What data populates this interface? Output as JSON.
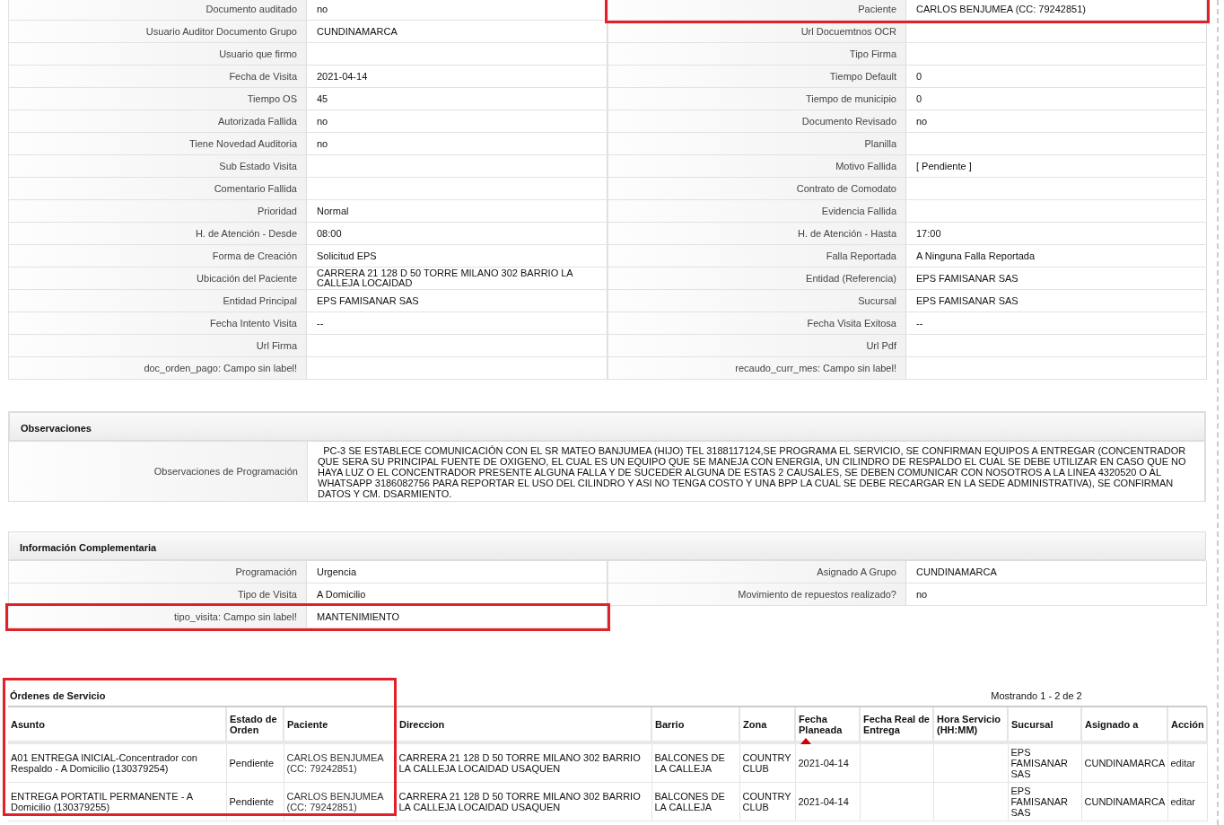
{
  "details": {
    "rows": [
      {
        "left": {
          "label": "Documento auditado",
          "value": "no"
        },
        "right": {
          "label": "Paciente",
          "value": "CARLOS BENJUMEA (CC: 79242851)",
          "highlighted": true
        }
      },
      {
        "left": {
          "label": "Usuario Auditor Documento Grupo",
          "value": "CUNDINAMARCA"
        },
        "right": {
          "label": "Url Docuemtnos OCR"
        }
      },
      {
        "left": {
          "label": "Usuario que firmo"
        },
        "right": {
          "label": "Tipo Firma"
        }
      },
      {
        "left": {
          "label": "Fecha de Visita",
          "value": "2021-04-14"
        },
        "right": {
          "label": "Tiempo Default",
          "value": "0"
        }
      },
      {
        "left": {
          "label": "Tiempo OS",
          "value": "45"
        },
        "right": {
          "label": "Tiempo de municipio",
          "value": "0"
        }
      },
      {
        "left": {
          "label": "Autorizada Fallida",
          "value": "no"
        },
        "right": {
          "label": "Documento Revisado",
          "value": "no"
        }
      },
      {
        "left": {
          "label": "Tiene Novedad Auditoria",
          "value": "no"
        },
        "right": {
          "label": "Planilla"
        }
      },
      {
        "left": {
          "label": "Sub Estado Visita"
        },
        "right": {
          "label": "Motivo Fallida",
          "value": "[ Pendiente ]"
        }
      },
      {
        "left": {
          "label": "Comentario Fallida"
        },
        "right": {
          "label": "Contrato de Comodato"
        }
      },
      {
        "left": {
          "label": "Prioridad",
          "value": "Normal"
        },
        "right": {
          "label": "Evidencia Fallida"
        }
      },
      {
        "left": {
          "label": "H. de Atención - Desde",
          "value": "08:00"
        },
        "right": {
          "label": "H. de Atención - Hasta",
          "value": "17:00"
        }
      },
      {
        "left": {
          "label": "Forma de Creación",
          "value": "Solicitud EPS"
        },
        "right": {
          "label": "Falla Reportada",
          "value": "A Ninguna Falla Reportada"
        }
      },
      {
        "left": {
          "label": "Ubicación del Paciente",
          "value": "CARRERA 21 128 D 50 TORRE MILANO 302 BARRIO LA CALLEJA LOCAIDAD"
        },
        "right": {
          "label": "Entidad (Referencia)",
          "value": "EPS FAMISANAR SAS"
        }
      },
      {
        "left": {
          "label": "Entidad Principal",
          "value": "EPS FAMISANAR SAS"
        },
        "right": {
          "label": "Sucursal",
          "value": "EPS FAMISANAR SAS"
        }
      },
      {
        "left": {
          "label": "Fecha Intento Visita",
          "value": "--"
        },
        "right": {
          "label": "Fecha Visita Exitosa",
          "value": "--"
        }
      },
      {
        "left": {
          "label": "Url Firma"
        },
        "right": {
          "label": "Url Pdf"
        }
      },
      {
        "left": {
          "label": "doc_orden_pago: Campo sin label!"
        },
        "right": {
          "label": "recaudo_curr_mes: Campo sin label!"
        }
      }
    ]
  },
  "observaciones": {
    "title": "Observaciones",
    "label": "Observaciones de Programación",
    "value": "  PC-3 SE ESTABLECE COMUNICACIÓN CON EL SR MATEO BANJUMEA (HIJO) TEL 3188117124,SE PROGRAMA EL SERVICIO, SE CONFIRMAN EQUIPOS A ENTREGAR (CONCENTRADOR QUE SERA SU PRINCIPAL FUENTE DE OXIGENO, EL CUAL ES UN EQUIPO QUE SE MANEJA CON ENERGIA, UN CILINDRO DE RESPALDO EL CUAL SE DEBE UTILIZAR EN CASO QUE NO HAYA LUZ O EL CONCENTRADOR PRESENTE ALGUNA FALLA Y DE SUCEDER ALGUNA DE ESTAS 2 CAUSALES, SE DEBEN COMUNICAR CON NOSOTROS A LA LINEA 4320520 O AL WHATSAPP 3186082756 PARA REPORTAR EL USO DEL CILINDRO Y ASI NO TENGA COSTO Y UNA BPP LA CUAL SE DEBE RECARGAR EN LA SEDE ADMINISTRATIVA), SE CONFIRMAN DATOS Y CM. DSARMIENTO."
  },
  "complementaria": {
    "title": "Información Complementaria",
    "rows": [
      {
        "left": {
          "label": "Programación",
          "value": "Urgencia"
        },
        "right": {
          "label": "Asignado A Grupo",
          "value": "CUNDINAMARCA"
        }
      },
      {
        "left": {
          "label": "Tipo de Visita",
          "value": "A Domicilio"
        },
        "right": {
          "label": "Movimiento de repuestos realizado?",
          "value": "no"
        }
      },
      {
        "left": {
          "label": "tipo_visita: Campo sin label!",
          "value": "MANTENIMIENTO",
          "highlighted": true
        }
      }
    ]
  },
  "orders": {
    "title": "Órdenes de Servicio",
    "highlighted": true,
    "paging": "Mostrando 1 - 2 de 2",
    "columns": [
      {
        "label": "Asunto",
        "sorted": false
      },
      {
        "label": "Estado de Orden",
        "sorted": false
      },
      {
        "label": "Paciente",
        "sorted": false
      },
      {
        "label": "Direccion",
        "sorted": false
      },
      {
        "label": "Barrio",
        "sorted": false
      },
      {
        "label": "Zona",
        "sorted": false
      },
      {
        "label": "Fecha Planeada",
        "sorted": true
      },
      {
        "label": "Fecha Real de Entrega",
        "sorted": false
      },
      {
        "label": "Hora Servicio (HH:MM)",
        "sorted": false
      },
      {
        "label": "Sucursal",
        "sorted": false
      },
      {
        "label": "Asignado a",
        "sorted": false
      },
      {
        "label": "Acción",
        "sorted": false
      }
    ],
    "rows": [
      {
        "cells": [
          "A01 ENTREGA INICIAL-Concentrador con Respaldo - A Domicilio (130379254)",
          "Pendiente",
          "CARLOS BENJUMEA (CC: 79242851)",
          "CARRERA 21 128 D 50 TORRE MILANO 302 BARRIO LA CALLEJA LOCAIDAD USAQUEN",
          "BALCONES DE LA CALLEJA",
          "COUNTRY CLUB",
          "2021-04-14",
          "",
          "",
          "EPS FAMISANAR SAS",
          "CUNDINAMARCA"
        ],
        "action": "editar"
      },
      {
        "cells": [
          "ENTREGA PORTATIL PERMANENTE - A Domicilio (130379255)",
          "Pendiente",
          "CARLOS BENJUMEA (CC: 79242851)",
          "CARRERA 21 128 D 50 TORRE MILANO 302 BARRIO LA CALLEJA LOCAIDAD USAQUEN",
          "BALCONES DE LA CALLEJA",
          "COUNTRY CLUB",
          "2021-04-14",
          "",
          "",
          "EPS FAMISANAR SAS",
          "CUNDINAMARCA"
        ],
        "action": "editar"
      }
    ]
  }
}
